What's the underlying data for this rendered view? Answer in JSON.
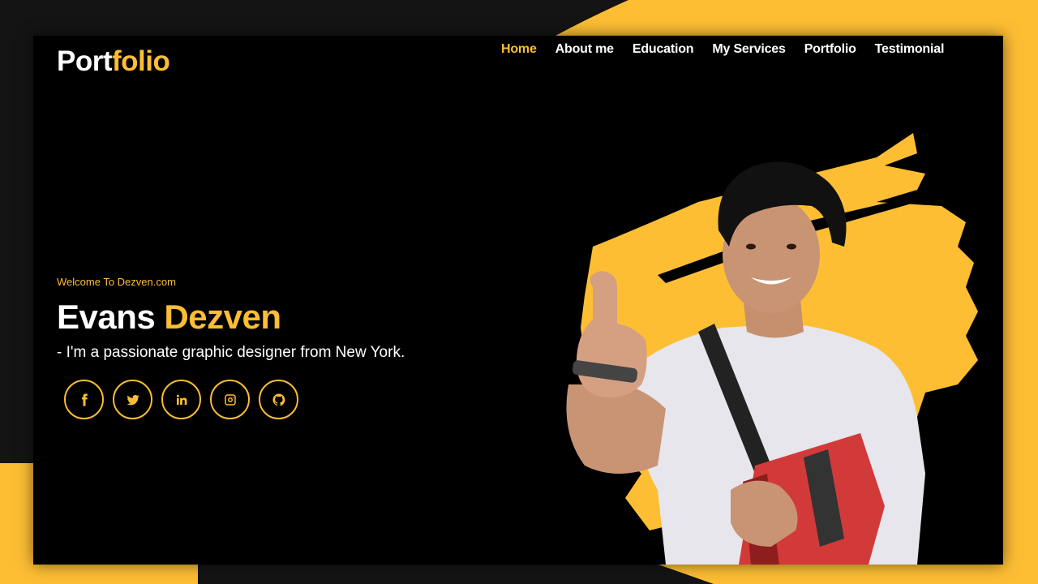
{
  "colors": {
    "accent": "#FDBE34",
    "background": "#141414",
    "frame": "#000000",
    "text": "#ffffff"
  },
  "logo": {
    "primary": "Port",
    "accent": "folio"
  },
  "nav": {
    "items": [
      {
        "label": "Home",
        "active": true
      },
      {
        "label": "About me",
        "active": false
      },
      {
        "label": "Education",
        "active": false
      },
      {
        "label": "My Services",
        "active": false
      },
      {
        "label": "Portfolio",
        "active": false
      },
      {
        "label": "Testimonial",
        "active": false
      }
    ]
  },
  "hero": {
    "welcome": "Welcome To Dezven.com",
    "first_name": "Evans",
    "last_name": "Dezven",
    "tagline": "- I'm a passionate graphic designer from New York.",
    "image_alt": "Smiling student giving thumbs up holding books"
  },
  "socials": [
    {
      "name": "facebook",
      "icon": "facebook-icon"
    },
    {
      "name": "twitter",
      "icon": "twitter-icon"
    },
    {
      "name": "linkedin",
      "icon": "linkedin-icon"
    },
    {
      "name": "instagram",
      "icon": "instagram-icon"
    },
    {
      "name": "github",
      "icon": "github-icon"
    }
  ]
}
